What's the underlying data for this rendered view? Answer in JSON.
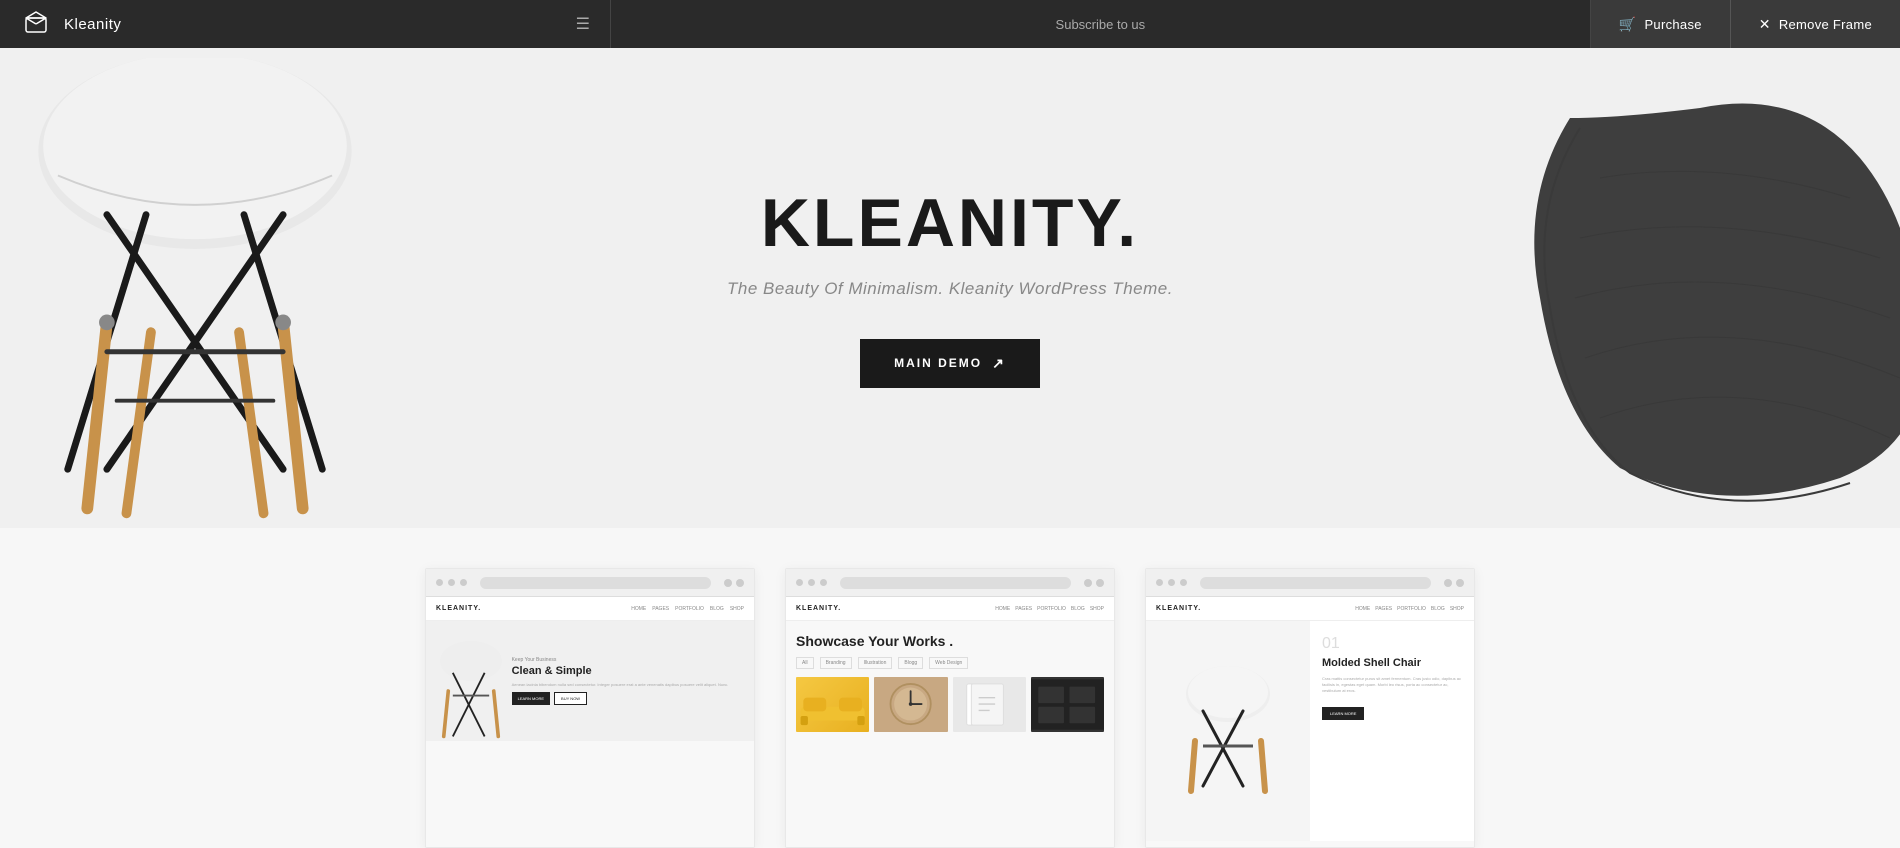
{
  "topbar": {
    "logo_icon": "box-icon",
    "title": "Kleanity",
    "hamburger_icon": "menu-icon",
    "subscribe_text": "Subscribe to us",
    "purchase_icon": "cart-icon",
    "purchase_label": "Purchase",
    "remove_icon": "close-icon",
    "remove_label": "Remove Frame"
  },
  "hero": {
    "title": "KLEANITY.",
    "subtitle": "The Beauty Of Minimalism. Kleanity WordPress Theme.",
    "cta_label": "MAIN DEMO",
    "cta_icon": "external-link-icon"
  },
  "previews": [
    {
      "id": "preview-business",
      "small_label": "Keep Your Business",
      "big_label": "Clean & Simple",
      "description": "Aenean lacinia bibendum nulla sed consectetur. Integer posuere erat a ante venenatis dapibus posuere velit aliquet. Nunc.",
      "btn1_label": "LEARN MORE",
      "btn2_label": "BUY NOW"
    },
    {
      "id": "preview-showcase",
      "nav_logo": "KLEANITY.",
      "title": "Showcase Your Works .",
      "filters": [
        "All",
        "Branding",
        "Illustration",
        "Blogg",
        "Web Design"
      ],
      "thumbs": [
        "yellow-sofa",
        "round-clock",
        "paper-docs",
        "dark-boxes"
      ]
    },
    {
      "id": "preview-molded",
      "nav_logo": "KLEANITY.",
      "number": "01",
      "title": "Molded Shell Chair",
      "description": "Cras mattis consectetur purus sit amet fermentum. Cras justo odio, dapibus ac facilisis in, egestas eget quam. Morbi leo risus, porta ac consectetur ac, vestibulum at eros.",
      "btn_label": "LEARN MORE"
    }
  ]
}
